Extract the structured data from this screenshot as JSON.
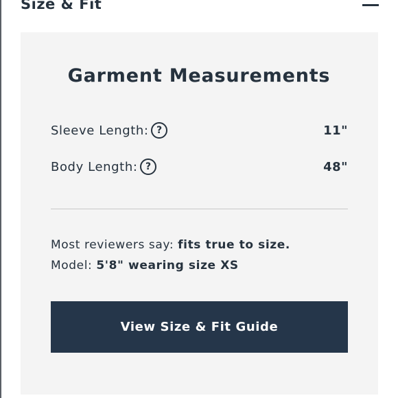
{
  "section": {
    "title": "Size & Fit",
    "collapse_icon": "minus-icon"
  },
  "panel": {
    "title": "Garment Measurements",
    "measurements": [
      {
        "label": "Sleeve Length:",
        "value": "11\"",
        "help_icon": "?"
      },
      {
        "label": "Body Length:",
        "value": "48\"",
        "help_icon": "?"
      }
    ],
    "reviewers": {
      "prefix": "Most reviewers say: ",
      "verdict": "fits true to size."
    },
    "model": {
      "prefix": "Model: ",
      "detail": "5'8\" wearing size XS"
    },
    "guide_button_label": "View Size & Fit Guide"
  },
  "colors": {
    "text": "#26323e",
    "panel_bg": "#f4f4f4",
    "button_bg": "#25364a",
    "divider": "#c9c9c9"
  }
}
